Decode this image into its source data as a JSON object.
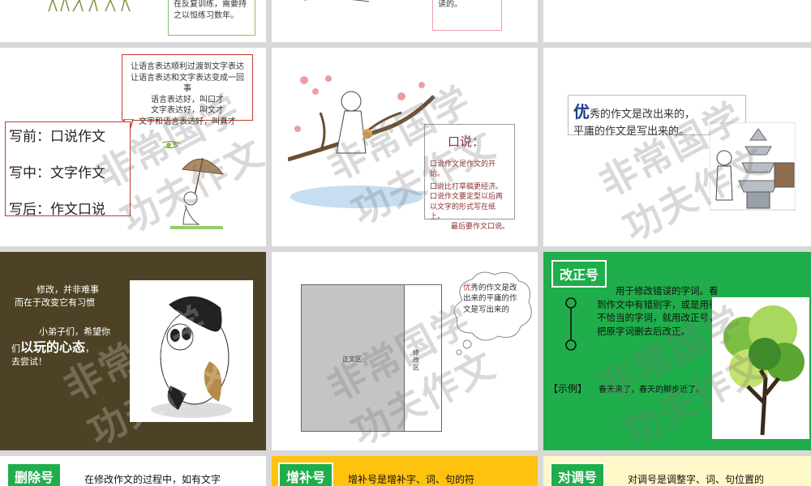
{
  "row1": {
    "s1_text": "在反复训练，需要持之以恒练习数年。",
    "s2_text": "读的。"
  },
  "slide4": {
    "callout_lines": [
      "让语言表达顺利过渡到文字表达",
      "让语言表达和文字表达变成一回事",
      "语言表达好，叫口才",
      "文字表达好，叫文才",
      "文字和语言表达好，叫真才"
    ],
    "items": [
      "写前：口说作文",
      "写中：文字作文",
      "写后：作文口说"
    ]
  },
  "slide5": {
    "title": "口说：",
    "lines": [
      "口说作文是作文的开始。",
      "口说比打草稿更经济。",
      "口说作文要定型以后再以文字的形式写在纸上。",
      "最后要作文口说。"
    ]
  },
  "slide6": {
    "lead_char": "优",
    "line1": "秀的作文是改出来的，",
    "line2": "平庸的作文是写出来的。"
  },
  "slide7": {
    "line1": "修改，并非难事",
    "line2": "而在于改变它有习惯",
    "line3": "小弟子们，希望你",
    "line4_prefix": "们",
    "line4_big": "以玩的心态",
    "line4_suffix": "，",
    "line5": "去尝试！"
  },
  "slide8": {
    "main_label": "正文区",
    "side_label": "修改区",
    "cloud_lead": "优",
    "cloud_text": "秀的作文是改出来的平庸的作文是写出来的"
  },
  "slide9": {
    "tag": "改正号",
    "text": "用于修改错误的字词。看到作文中有错别字，或是用得不恰当的字词，就用改正号，把原字词删去后改正。",
    "example_label": "【示例】",
    "example_text": "春天来了，春天的脚步近了。"
  },
  "row4": {
    "s10_tag": "删除号",
    "s10_text": "在修改作文的过程中，如有文字",
    "s11_tag": "增补号",
    "s11_text": "增补号是增补字、词、句的符",
    "s12_tag": "对调号",
    "s12_text": "对调号是调整字、词、句位置的"
  },
  "watermark": {
    "line1": "非常国学",
    "line2": "功夫作文"
  },
  "colors": {
    "red": "#c0392b",
    "olive": "#4d4225",
    "green": "#1fae4b",
    "yellow": "#ffc20e"
  }
}
